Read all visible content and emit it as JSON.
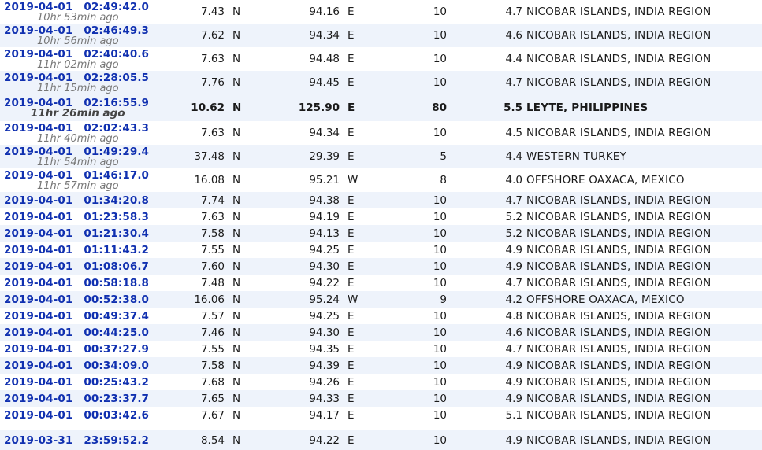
{
  "quakes": [
    {
      "date": "2019-04-01",
      "time": "02:49:42.0",
      "ago": "10hr 53min ago",
      "lat": "7.43",
      "ns": "N",
      "lon": "94.16",
      "ew": "E",
      "depth": "10",
      "mag": "4.7",
      "region": "NICOBAR ISLANDS, INDIA REGION"
    },
    {
      "date": "2019-04-01",
      "time": "02:46:49.3",
      "ago": "10hr 56min ago",
      "lat": "7.62",
      "ns": "N",
      "lon": "94.34",
      "ew": "E",
      "depth": "10",
      "mag": "4.6",
      "region": "NICOBAR ISLANDS, INDIA REGION"
    },
    {
      "date": "2019-04-01",
      "time": "02:40:40.6",
      "ago": "11hr 02min ago",
      "lat": "7.63",
      "ns": "N",
      "lon": "94.48",
      "ew": "E",
      "depth": "10",
      "mag": "4.4",
      "region": "NICOBAR ISLANDS, INDIA REGION"
    },
    {
      "date": "2019-04-01",
      "time": "02:28:05.5",
      "ago": "11hr 15min ago",
      "lat": "7.76",
      "ns": "N",
      "lon": "94.45",
      "ew": "E",
      "depth": "10",
      "mag": "4.7",
      "region": "NICOBAR ISLANDS, INDIA REGION"
    },
    {
      "date": "2019-04-01",
      "time": "02:16:55.9",
      "ago": "11hr 26min ago",
      "lat": "10.62",
      "ns": "N",
      "lon": "125.90",
      "ew": "E",
      "depth": "80",
      "mag": "5.5",
      "region": "LEYTE, PHILIPPINES"
    },
    {
      "date": "2019-04-01",
      "time": "02:02:43.3",
      "ago": "11hr 40min ago",
      "lat": "7.63",
      "ns": "N",
      "lon": "94.34",
      "ew": "E",
      "depth": "10",
      "mag": "4.5",
      "region": "NICOBAR ISLANDS, INDIA REGION"
    },
    {
      "date": "2019-04-01",
      "time": "01:49:29.4",
      "ago": "11hr 54min ago",
      "lat": "37.48",
      "ns": "N",
      "lon": "29.39",
      "ew": "E",
      "depth": "5",
      "mag": "4.4",
      "region": "WESTERN TURKEY"
    },
    {
      "date": "2019-04-01",
      "time": "01:46:17.0",
      "ago": "11hr 57min ago",
      "lat": "16.08",
      "ns": "N",
      "lon": "95.21",
      "ew": "W",
      "depth": "8",
      "mag": "4.0",
      "region": "OFFSHORE OAXACA, MEXICO"
    },
    {
      "date": "2019-04-01",
      "time": "01:34:20.8",
      "lat": "7.74",
      "ns": "N",
      "lon": "94.38",
      "ew": "E",
      "depth": "10",
      "mag": "4.7",
      "region": "NICOBAR ISLANDS, INDIA REGION"
    },
    {
      "date": "2019-04-01",
      "time": "01:23:58.3",
      "lat": "7.63",
      "ns": "N",
      "lon": "94.19",
      "ew": "E",
      "depth": "10",
      "mag": "5.2",
      "region": "NICOBAR ISLANDS, INDIA REGION"
    },
    {
      "date": "2019-04-01",
      "time": "01:21:30.4",
      "lat": "7.58",
      "ns": "N",
      "lon": "94.13",
      "ew": "E",
      "depth": "10",
      "mag": "5.2",
      "region": "NICOBAR ISLANDS, INDIA REGION"
    },
    {
      "date": "2019-04-01",
      "time": "01:11:43.2",
      "lat": "7.55",
      "ns": "N",
      "lon": "94.25",
      "ew": "E",
      "depth": "10",
      "mag": "4.9",
      "region": "NICOBAR ISLANDS, INDIA REGION"
    },
    {
      "date": "2019-04-01",
      "time": "01:08:06.7",
      "lat": "7.60",
      "ns": "N",
      "lon": "94.30",
      "ew": "E",
      "depth": "10",
      "mag": "4.9",
      "region": "NICOBAR ISLANDS, INDIA REGION"
    },
    {
      "date": "2019-04-01",
      "time": "00:58:18.8",
      "lat": "7.48",
      "ns": "N",
      "lon": "94.22",
      "ew": "E",
      "depth": "10",
      "mag": "4.7",
      "region": "NICOBAR ISLANDS, INDIA REGION"
    },
    {
      "date": "2019-04-01",
      "time": "00:52:38.0",
      "lat": "16.06",
      "ns": "N",
      "lon": "95.24",
      "ew": "W",
      "depth": "9",
      "mag": "4.2",
      "region": "OFFSHORE OAXACA, MEXICO"
    },
    {
      "date": "2019-04-01",
      "time": "00:49:37.4",
      "lat": "7.57",
      "ns": "N",
      "lon": "94.25",
      "ew": "E",
      "depth": "10",
      "mag": "4.8",
      "region": "NICOBAR ISLANDS, INDIA REGION"
    },
    {
      "date": "2019-04-01",
      "time": "00:44:25.0",
      "lat": "7.46",
      "ns": "N",
      "lon": "94.30",
      "ew": "E",
      "depth": "10",
      "mag": "4.6",
      "region": "NICOBAR ISLANDS, INDIA REGION"
    },
    {
      "date": "2019-04-01",
      "time": "00:37:27.9",
      "lat": "7.55",
      "ns": "N",
      "lon": "94.35",
      "ew": "E",
      "depth": "10",
      "mag": "4.7",
      "region": "NICOBAR ISLANDS, INDIA REGION"
    },
    {
      "date": "2019-04-01",
      "time": "00:34:09.0",
      "lat": "7.58",
      "ns": "N",
      "lon": "94.39",
      "ew": "E",
      "depth": "10",
      "mag": "4.9",
      "region": "NICOBAR ISLANDS, INDIA REGION"
    },
    {
      "date": "2019-04-01",
      "time": "00:25:43.2",
      "lat": "7.68",
      "ns": "N",
      "lon": "94.26",
      "ew": "E",
      "depth": "10",
      "mag": "4.9",
      "region": "NICOBAR ISLANDS, INDIA REGION"
    },
    {
      "date": "2019-04-01",
      "time": "00:23:37.7",
      "lat": "7.65",
      "ns": "N",
      "lon": "94.33",
      "ew": "E",
      "depth": "10",
      "mag": "4.9",
      "region": "NICOBAR ISLANDS, INDIA REGION"
    },
    {
      "date": "2019-04-01",
      "time": "00:03:42.6",
      "lat": "7.67",
      "ns": "N",
      "lon": "94.17",
      "ew": "E",
      "depth": "10",
      "mag": "5.1",
      "region": "NICOBAR ISLANDS, INDIA REGION"
    },
    {
      "date": "2019-03-31",
      "time": "23:59:52.2",
      "lat": "8.54",
      "ns": "N",
      "lon": "94.22",
      "ew": "E",
      "depth": "10",
      "mag": "4.9",
      "region": "NICOBAR ISLANDS, INDIA REGION"
    }
  ],
  "colors": {
    "link": "#1030b0",
    "ago_text": "#777777",
    "alt_row_bg": "#eef3fb",
    "text": "#1a1a1a"
  }
}
